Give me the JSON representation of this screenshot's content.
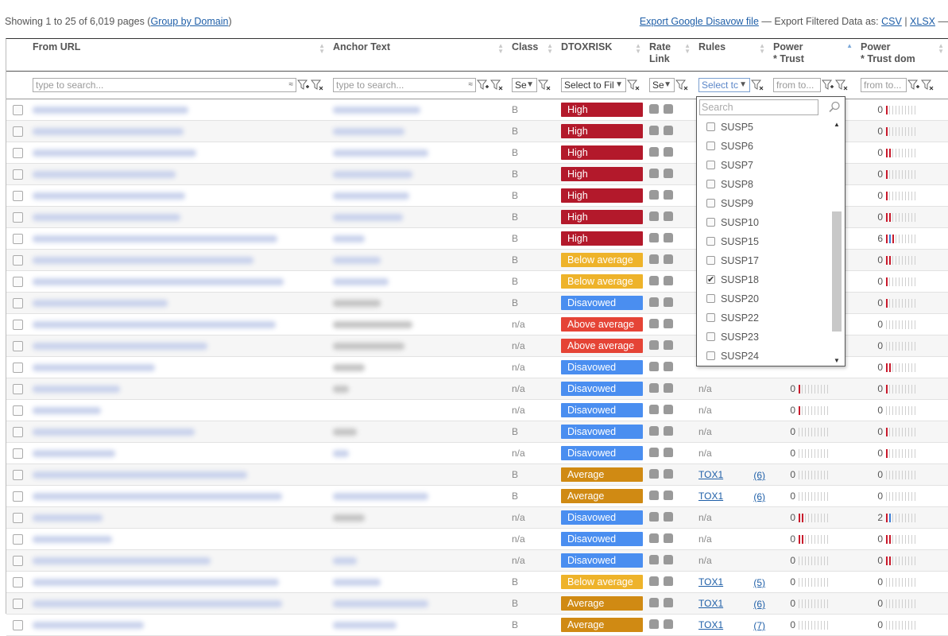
{
  "topbar": {
    "showing_prefix": "Showing 1 to 25 of 6,019 pages (",
    "group_by_domain": "Group by Domain",
    "showing_suffix": ")",
    "export_disavow": "Export Google Disavow file",
    "export_sep": " — Export Filtered Data as: ",
    "csv": "CSV",
    "pipe": " | ",
    "xlsx": "XLSX",
    "tail": " —"
  },
  "columns": {
    "from_url": "From URL",
    "anchor_text": "Anchor Text",
    "class": "Class",
    "dtoxrisk": "DTOXRISK",
    "rate_link_1": "Rate",
    "rate_link_2": "Link",
    "rules": "Rules",
    "power_trust_1": "Power",
    "power_trust_2": "* Trust",
    "power_trust_dom_1": "Power",
    "power_trust_dom_2": "* Trust dom"
  },
  "filters": {
    "url_placeholder": "type to search...",
    "anchor_placeholder": "type to search...",
    "class_select": "Se",
    "dtox_select": "Select to Fil",
    "rate_select": "Se",
    "rules_select": "Select tc",
    "from_to": "from to..."
  },
  "rules_dropdown": {
    "search_placeholder": "Search",
    "items": [
      {
        "label": "SUSP5",
        "checked": false
      },
      {
        "label": "SUSP6",
        "checked": false
      },
      {
        "label": "SUSP7",
        "checked": false
      },
      {
        "label": "SUSP8",
        "checked": false
      },
      {
        "label": "SUSP9",
        "checked": false
      },
      {
        "label": "SUSP10",
        "checked": false
      },
      {
        "label": "SUSP15",
        "checked": false
      },
      {
        "label": "SUSP17",
        "checked": false
      },
      {
        "label": "SUSP18",
        "checked": true
      },
      {
        "label": "SUSP20",
        "checked": false
      },
      {
        "label": "SUSP22",
        "checked": false
      },
      {
        "label": "SUSP23",
        "checked": false
      },
      {
        "label": "SUSP24",
        "checked": false
      }
    ]
  },
  "colors": {
    "High": "#b3192b",
    "Below average": "#eeb32a",
    "Disavowed": "#4a8ef0",
    "Above average": "#e54436",
    "Average": "#d08a13"
  },
  "rows": [
    {
      "cls": "B",
      "risk": "High",
      "rules": "",
      "cnt": "",
      "pt": "",
      "ptd": "0",
      "ptd_bars": [
        "r"
      ]
    },
    {
      "cls": "B",
      "risk": "High",
      "rules": "",
      "cnt": "",
      "pt": "",
      "ptd": "0",
      "ptd_bars": [
        "r"
      ]
    },
    {
      "cls": "B",
      "risk": "High",
      "rules": "",
      "cnt": "",
      "pt": "",
      "ptd": "0",
      "ptd_bars": [
        "r",
        "r"
      ]
    },
    {
      "cls": "B",
      "risk": "High",
      "rules": "",
      "cnt": "",
      "pt": "",
      "ptd": "0",
      "ptd_bars": [
        "r"
      ]
    },
    {
      "cls": "B",
      "risk": "High",
      "rules": "",
      "cnt": "",
      "pt": "",
      "ptd": "0",
      "ptd_bars": [
        "r"
      ]
    },
    {
      "cls": "B",
      "risk": "High",
      "rules": "",
      "cnt": "",
      "pt": "",
      "ptd": "0",
      "ptd_bars": [
        "r",
        "r"
      ]
    },
    {
      "cls": "B",
      "risk": "High",
      "rules": "",
      "cnt": "",
      "pt": "",
      "ptd": "6",
      "ptd_bars": [
        "r",
        "b",
        "r"
      ]
    },
    {
      "cls": "B",
      "risk": "Below average",
      "rules": "",
      "cnt": "",
      "pt": "",
      "ptd": "0",
      "ptd_bars": [
        "r",
        "r"
      ]
    },
    {
      "cls": "B",
      "risk": "Below average",
      "rules": "",
      "cnt": "",
      "pt": "",
      "ptd": "0",
      "ptd_bars": [
        "r"
      ]
    },
    {
      "cls": "B",
      "risk": "Disavowed",
      "rules": "",
      "cnt": "",
      "pt": "",
      "ptd": "0",
      "ptd_bars": [
        "r"
      ]
    },
    {
      "cls": "n/a",
      "risk": "Above average",
      "rules": "",
      "cnt": "",
      "pt": "",
      "ptd": "0",
      "ptd_bars": []
    },
    {
      "cls": "n/a",
      "risk": "Above average",
      "rules": "",
      "cnt": "",
      "pt": "",
      "ptd": "0",
      "ptd_bars": []
    },
    {
      "cls": "n/a",
      "risk": "Disavowed",
      "rules": "",
      "cnt": "",
      "pt": "",
      "ptd": "0",
      "ptd_bars": [
        "r",
        "r"
      ]
    },
    {
      "cls": "n/a",
      "risk": "Disavowed",
      "rules": "n/a",
      "cnt": "",
      "pt": "0",
      "pt_bars": [
        "r"
      ],
      "ptd": "0",
      "ptd_bars": [
        "r"
      ]
    },
    {
      "cls": "n/a",
      "risk": "Disavowed",
      "rules": "n/a",
      "cnt": "",
      "pt": "0",
      "pt_bars": [
        "r"
      ],
      "ptd": "0",
      "ptd_bars": []
    },
    {
      "cls": "B",
      "risk": "Disavowed",
      "rules": "n/a",
      "cnt": "",
      "pt": "0",
      "pt_bars": [],
      "ptd": "0",
      "ptd_bars": [
        "r"
      ]
    },
    {
      "cls": "n/a",
      "risk": "Disavowed",
      "rules": "n/a",
      "cnt": "",
      "pt": "0",
      "pt_bars": [],
      "ptd": "0",
      "ptd_bars": [
        "r"
      ]
    },
    {
      "cls": "B",
      "risk": "Average",
      "rules": "TOX1",
      "cnt": "(6)",
      "pt": "0",
      "pt_bars": [],
      "ptd": "0",
      "ptd_bars": []
    },
    {
      "cls": "B",
      "risk": "Average",
      "rules": "TOX1",
      "cnt": "(6)",
      "pt": "0",
      "pt_bars": [],
      "ptd": "0",
      "ptd_bars": []
    },
    {
      "cls": "n/a",
      "risk": "Disavowed",
      "rules": "n/a",
      "cnt": "",
      "pt": "0",
      "pt_bars": [
        "r",
        "r"
      ],
      "ptd": "2",
      "ptd_bars": [
        "r",
        "b"
      ]
    },
    {
      "cls": "n/a",
      "risk": "Disavowed",
      "rules": "n/a",
      "cnt": "",
      "pt": "0",
      "pt_bars": [
        "r",
        "r"
      ],
      "ptd": "0",
      "ptd_bars": [
        "r",
        "r"
      ]
    },
    {
      "cls": "n/a",
      "risk": "Disavowed",
      "rules": "n/a",
      "cnt": "",
      "pt": "0",
      "pt_bars": [],
      "ptd": "0",
      "ptd_bars": [
        "r",
        "r"
      ]
    },
    {
      "cls": "B",
      "risk": "Below average",
      "rules": "TOX1",
      "cnt": "(5)",
      "pt": "0",
      "pt_bars": [],
      "ptd": "0",
      "ptd_bars": []
    },
    {
      "cls": "B",
      "risk": "Average",
      "rules": "TOX1",
      "cnt": "(6)",
      "pt": "0",
      "pt_bars": [],
      "ptd": "0",
      "ptd_bars": []
    },
    {
      "cls": "B",
      "risk": "Average",
      "rules": "TOX1",
      "cnt": "(7)",
      "pt": "0",
      "pt_bars": [],
      "ptd": "0",
      "ptd_bars": []
    }
  ]
}
